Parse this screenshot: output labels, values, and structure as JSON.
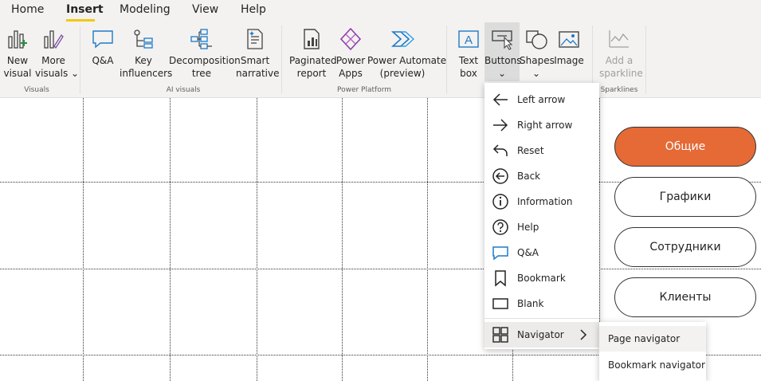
{
  "tabs": [
    {
      "label": "Home"
    },
    {
      "label": "Insert"
    },
    {
      "label": "Modeling"
    },
    {
      "label": "View"
    },
    {
      "label": "Help"
    }
  ],
  "ribbon": {
    "visuals": {
      "group_label": "Visuals",
      "new_visual": [
        "New",
        "visual"
      ],
      "more_visuals": [
        "More",
        "visuals"
      ]
    },
    "ai": {
      "group_label": "AI visuals",
      "qa": "Q&A",
      "key_influencers": [
        "Key",
        "influencers"
      ],
      "decomposition_tree": [
        "Decomposition",
        "tree"
      ],
      "smart_narrative": [
        "Smart",
        "narrative"
      ]
    },
    "power_platform": {
      "group_label": "Power Platform",
      "paginated_report": [
        "Paginated",
        "report"
      ],
      "power_apps": [
        "Power",
        "Apps"
      ],
      "power_automate": [
        "Power Automate",
        "(preview)"
      ]
    },
    "elements": {
      "text_box": [
        "Text",
        "box"
      ],
      "buttons": "Buttons",
      "shapes": "Shapes",
      "image": "Image"
    },
    "sparklines": {
      "group_label": "Sparklines",
      "add_sparkline": [
        "Add a",
        "sparkline"
      ]
    }
  },
  "buttons_menu": {
    "items": [
      {
        "label": "Left arrow",
        "icon": "left-arrow-icon"
      },
      {
        "label": "Right arrow",
        "icon": "right-arrow-icon"
      },
      {
        "label": "Reset",
        "icon": "reset-icon"
      },
      {
        "label": "Back",
        "icon": "back-icon"
      },
      {
        "label": "Information",
        "icon": "information-icon"
      },
      {
        "label": "Help",
        "icon": "help-icon"
      },
      {
        "label": "Q&A",
        "icon": "qa-icon"
      },
      {
        "label": "Bookmark",
        "icon": "bookmark-icon"
      },
      {
        "label": "Blank",
        "icon": "blank-icon"
      },
      {
        "label": "Navigator",
        "icon": "navigator-icon"
      }
    ],
    "submenu": [
      {
        "label": "Page navigator"
      },
      {
        "label": "Bookmark navigator"
      }
    ]
  },
  "canvas_buttons": [
    {
      "label": "Общие"
    },
    {
      "label": "Графики"
    },
    {
      "label": "Сотрудники"
    },
    {
      "label": "Клиенты"
    }
  ],
  "colors": {
    "accent_underline": "#f2c811",
    "active_button": "#e56a35",
    "ribbon_bg": "#f3f2f1"
  }
}
